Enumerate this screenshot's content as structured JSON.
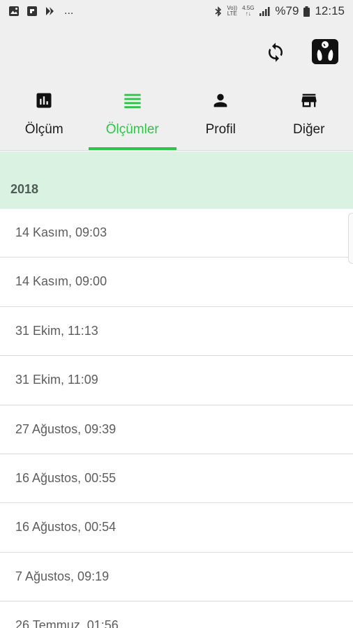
{
  "status_bar": {
    "left_icons": [
      "image-icon",
      "gallery-icon",
      "download-icon"
    ],
    "overflow": "...",
    "network_top": "Vo))",
    "network_bottom": "LTE",
    "data_top": "4.5G",
    "data_bottom": "↑↓",
    "battery": "%79",
    "time": "12:15"
  },
  "app_bar": {
    "actions": [
      "sync-icon",
      "scale-device-icon"
    ]
  },
  "tabs": [
    {
      "label": "Ölçüm",
      "icon": "bar-chart-icon"
    },
    {
      "label": "Ölçümler",
      "icon": "list-icon",
      "active": true
    },
    {
      "label": "Profil",
      "icon": "person-icon"
    },
    {
      "label": "Diğer",
      "icon": "store-icon"
    }
  ],
  "colors": {
    "accent": "#2ec44a",
    "header_bg": "#efefef",
    "year_bg": "#d9f2e2"
  },
  "measurements": {
    "year": "2018",
    "items": [
      "14 Kasım, 09:03",
      "14 Kasım, 09:00",
      "31 Ekim, 11:13",
      "31 Ekim, 11:09",
      "27 Ağustos, 09:39",
      "16 Ağustos, 00:55",
      "16 Ağustos, 00:54",
      "7 Ağustos, 09:19",
      "26 Temmuz, 01:56"
    ]
  }
}
